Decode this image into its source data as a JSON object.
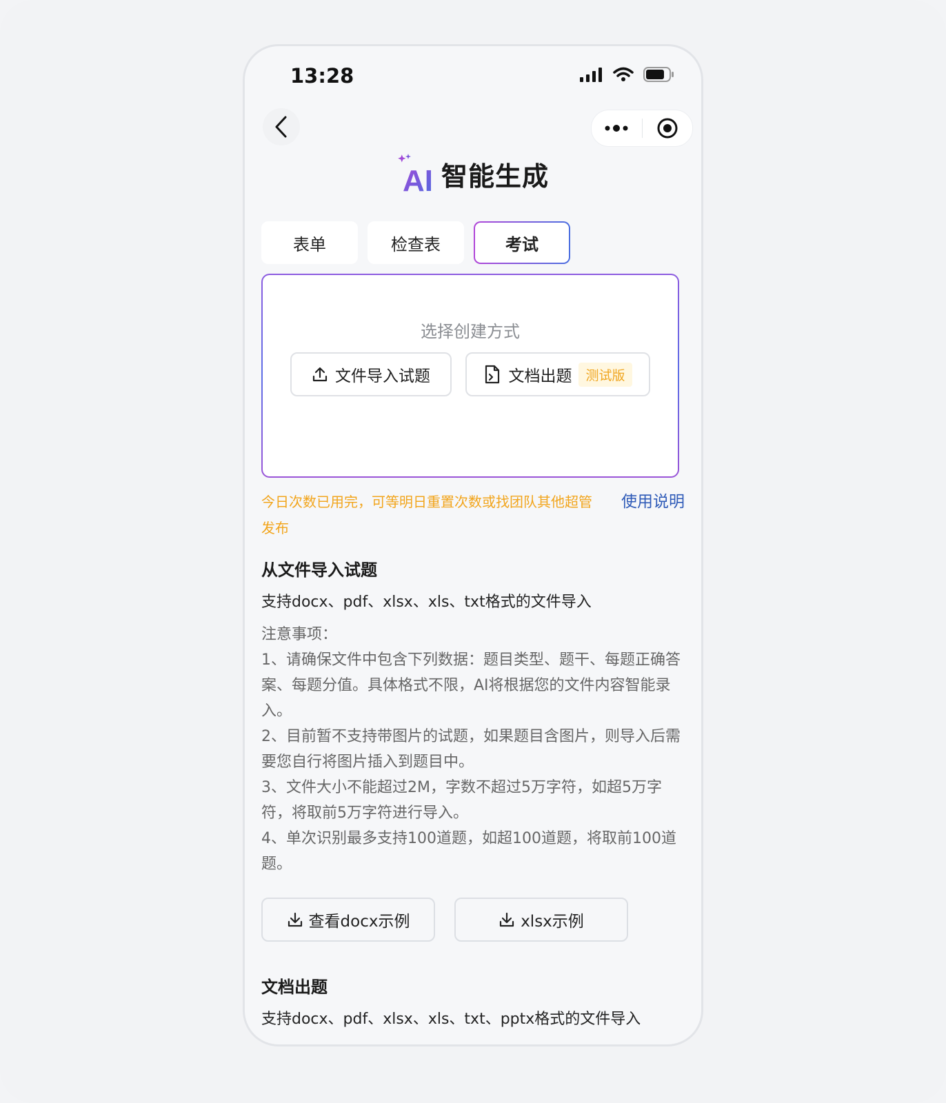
{
  "status_bar": {
    "time": "13:28"
  },
  "brand": {
    "ai_mark": "AI",
    "title": "智能生成"
  },
  "tabs": [
    {
      "label": "表单",
      "active": false
    },
    {
      "label": "检查表",
      "active": false
    },
    {
      "label": "考试",
      "active": true
    }
  ],
  "panel": {
    "title": "选择创建方式",
    "import_button": "文件导入试题",
    "doc_button": "文档出题",
    "beta_badge": "测试版"
  },
  "warning": "今日次数已用完，可等明日重置次数或找团队其他超管发布",
  "help_link": "使用说明",
  "section_import": {
    "title": "从文件导入试题",
    "formats": "支持docx、pdf、xlsx、xls、txt格式的文件导入",
    "notes_label": "注意事项：",
    "notes": [
      "1、请确保文件中包含下列数据：题目类型、题干、每题正确答案、每题分值。具体格式不限，AI将根据您的文件内容智能录入。",
      "2、目前暂不支持带图片的试题，如果题目含图片，则导入后需要您自行将图片插入到题目中。",
      "3、文件大小不能超过2M，字数不超过5万字符，如超5万字符，将取前5万字符进行导入。",
      "4、单次识别最多支持100道题，如超100道题，将取前100道题。"
    ],
    "docx_example": "查看docx示例",
    "xlsx_example": "xlsx示例"
  },
  "section_doc": {
    "title": "文档出题",
    "formats": "支持docx、pdf、xlsx、xls、txt、pptx格式的文件导入"
  },
  "colors": {
    "accent_purple": "#8c5be0",
    "accent_blue": "#4b6fe0",
    "warning": "#f2a51c",
    "link": "#2f5bb8"
  }
}
